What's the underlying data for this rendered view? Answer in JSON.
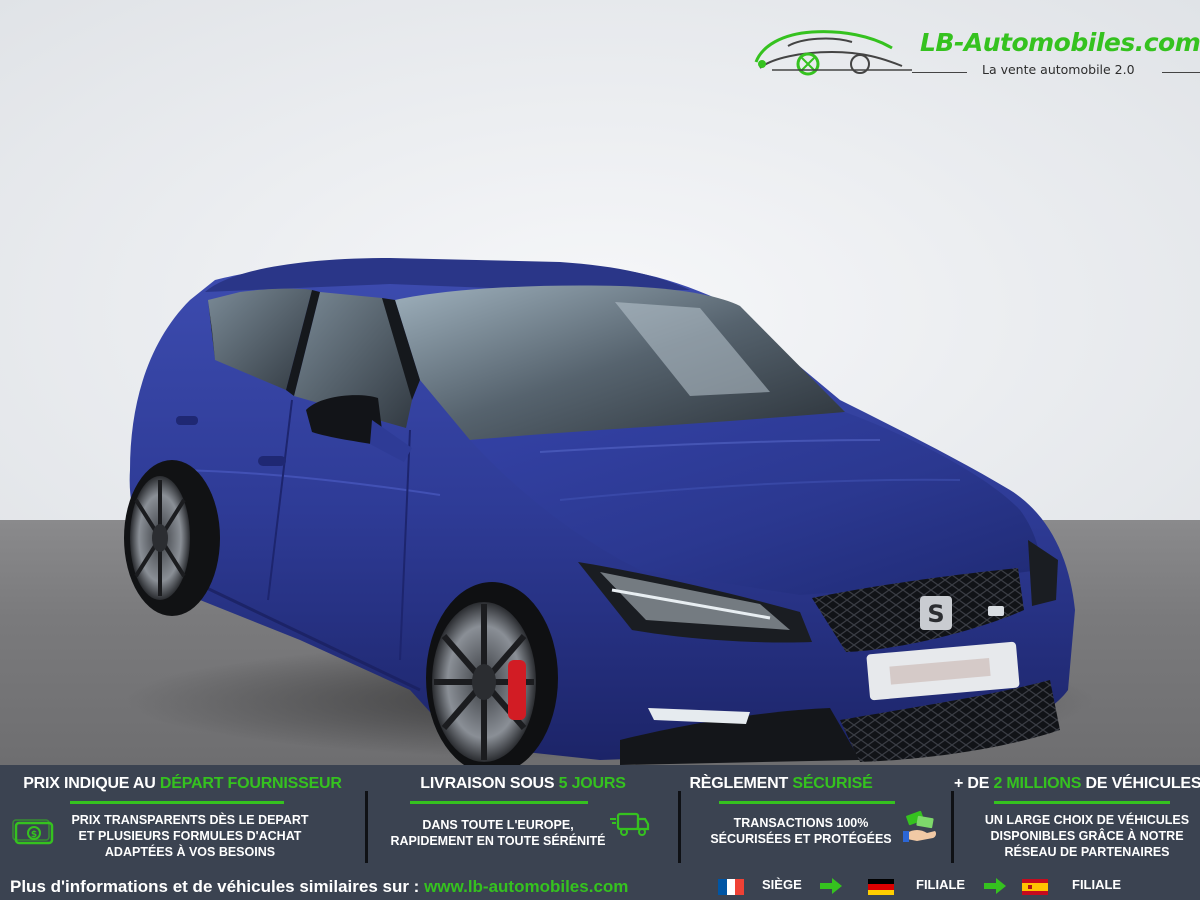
{
  "brand": {
    "name": "LB-Automobiles.com",
    "tagline": "La vente automobile 2.0",
    "accent_color": "#35c21f",
    "band_color": "#3b4351"
  },
  "photo": {
    "vehicle_color": "#2e3b96",
    "grille_badge": "S"
  },
  "features": [
    {
      "title_prefix": "PRIX INDIQUE AU ",
      "title_highlight": "DÉPART FOURNISSEUR",
      "title_suffix": "",
      "lines": [
        "PRIX TRANSPARENTS DÈS LE DEPART",
        "ET PLUSIEURS FORMULES D'ACHAT",
        "ADAPTÉES À VOS BESOINS"
      ],
      "icon": "money-icon"
    },
    {
      "title_prefix": "LIVRAISON SOUS ",
      "title_highlight": "5 JOURS",
      "title_suffix": "",
      "lines": [
        "DANS TOUTE L'EUROPE,",
        "RAPIDEMENT EN TOUTE SÉRÉNITÉ"
      ],
      "icon": "truck-icon"
    },
    {
      "title_prefix": "RÈGLEMENT ",
      "title_highlight": "SÉCURISÉ",
      "title_suffix": "",
      "lines": [
        "TRANSACTIONS 100%",
        "SÉCURISÉES ET PROTÉGÉES"
      ],
      "icon": "payment-hand-icon"
    },
    {
      "title_prefix": "+ DE ",
      "title_highlight": "2 MILLIONS",
      "title_suffix": " DE VÉHICULES",
      "lines": [
        "UN LARGE CHOIX DE VÉHICULES",
        "DISPONIBLES GRÂCE À NOTRE",
        "RÉSEAU DE PARTENAIRES"
      ],
      "icon": ""
    }
  ],
  "footer": {
    "info_text": "Plus d'informations et de véhicules similaires sur : ",
    "url": "www.lb-automobiles.com",
    "locations": [
      {
        "flag": "france-flag-icon",
        "label": "SIÈGE"
      },
      {
        "flag": "germany-flag-icon",
        "label": "FILIALE"
      },
      {
        "flag": "spain-flag-icon",
        "label": "FILIALE"
      }
    ]
  }
}
